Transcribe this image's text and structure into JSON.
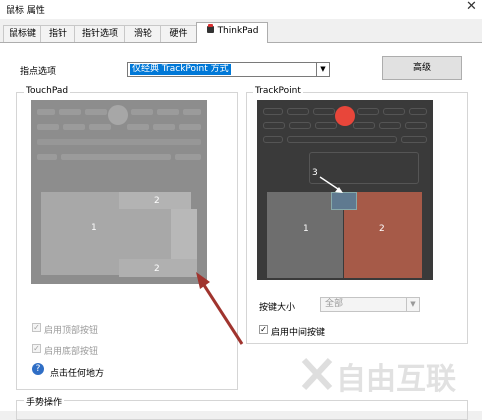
{
  "window": {
    "title": "鼠标 属性",
    "close_label": "✕"
  },
  "tabs": [
    {
      "label": "鼠标键"
    },
    {
      "label": "指针"
    },
    {
      "label": "指针选项"
    },
    {
      "label": "滑轮"
    },
    {
      "label": "硬件"
    },
    {
      "label": "ThinkPad",
      "active": true
    }
  ],
  "pointing": {
    "label": "指点选项",
    "selected": "仅经典 TrackPoint 方式",
    "advanced_label": "高级"
  },
  "touchpad": {
    "group_title": "TouchPad",
    "zone_labels": [
      "1",
      "2",
      "2"
    ],
    "top_button_label": "启用顶部按钮",
    "top_button_checked": true,
    "bottom_button_label": "启用底部按钮",
    "bottom_button_checked": true,
    "help_label": "点击任何地方"
  },
  "trackpoint": {
    "group_title": "TrackPoint",
    "zone_labels": [
      "3",
      "1",
      "2"
    ],
    "button_size_label": "按键大小",
    "button_size_value": "全部",
    "middle_button_label": "启用中间按键",
    "middle_button_checked": true
  },
  "gestures": {
    "group_title": "手势操作"
  },
  "watermark": {
    "text": "自由互联"
  },
  "colors": {
    "trackpoint_dot": "#e8463a",
    "right_zone": "#a65a48",
    "annotation_arrow": "#a0342e",
    "selection": "#0078d7"
  }
}
